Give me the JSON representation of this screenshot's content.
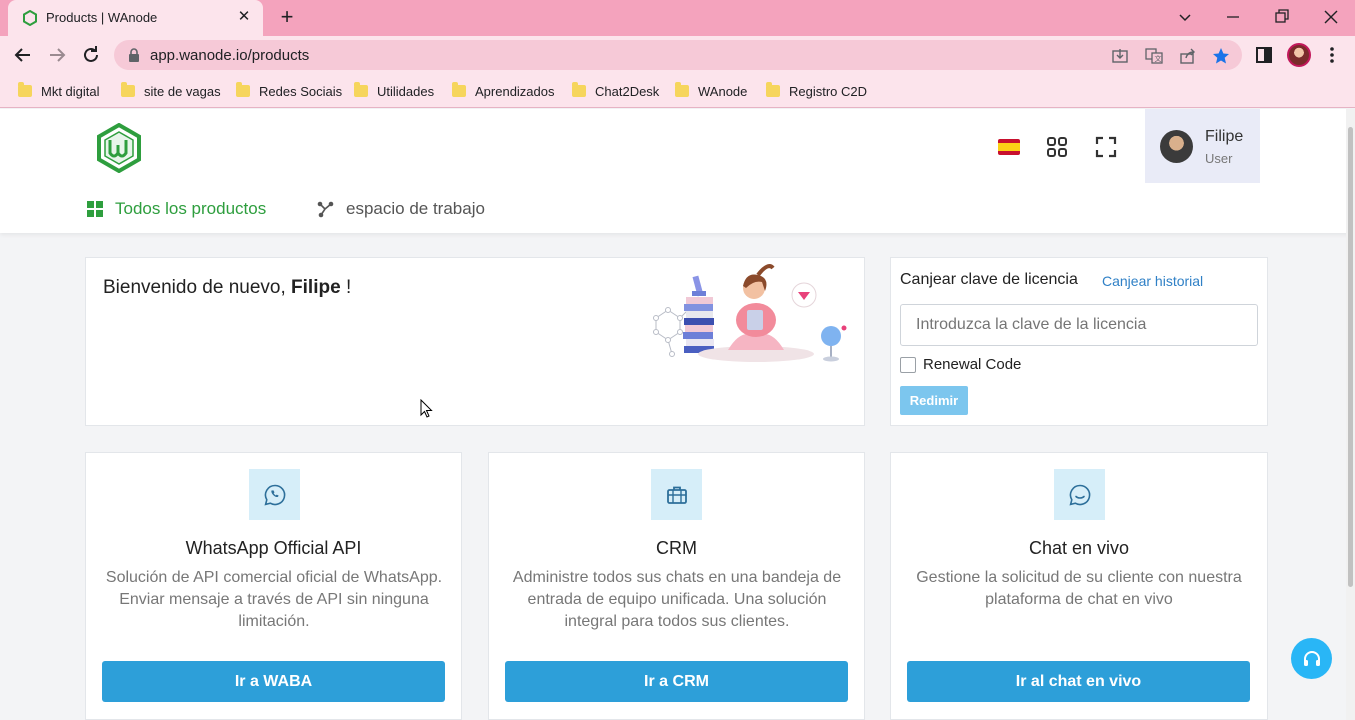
{
  "browser": {
    "tab_title": "Products | WAnode",
    "url": "app.wanode.io/products",
    "bookmarks": [
      "Mkt digital",
      "site de vagas",
      "Redes Sociais",
      "Utilidades",
      "Aprendizados",
      "Chat2Desk",
      "WAnode",
      "Registro C2D"
    ]
  },
  "header": {
    "user_name": "Filipe",
    "user_role": "User",
    "nav": [
      {
        "label": "Todos los productos"
      },
      {
        "label": "espacio de trabajo"
      }
    ]
  },
  "welcome": {
    "greeting": "Bienvenido de nuevo, ",
    "name": "Filipe",
    "suffix": " !"
  },
  "license": {
    "title": "Canjear clave de licencia",
    "history_link": "Canjear historial",
    "placeholder": "Introduzca la clave de la licencia",
    "checkbox_label": "Renewal Code",
    "button": "Redimir"
  },
  "products": [
    {
      "icon": "whatsapp-icon",
      "title": "WhatsApp Official API",
      "description": "Solución de API comercial oficial de WhatsApp. Enviar mensaje a través de API sin ninguna limitación.",
      "button": "Ir a WABA"
    },
    {
      "icon": "briefcase-icon",
      "title": "CRM",
      "description": "Administre todos sus chats en una bandeja de entrada de equipo unificada. Una solución integral para todos sus clientes.",
      "button": "Ir a CRM"
    },
    {
      "icon": "chat-icon",
      "title": "Chat en vivo",
      "description": "Gestione la solicitud de su cliente con nuestra plataforma de chat en vivo",
      "button": "Ir al chat en vivo"
    }
  ],
  "colors": {
    "accent_green": "#2e9e3e",
    "primary_blue": "#2d9fd9",
    "link_blue": "#2f80c6",
    "chrome_pink": "#f4a3bd"
  }
}
